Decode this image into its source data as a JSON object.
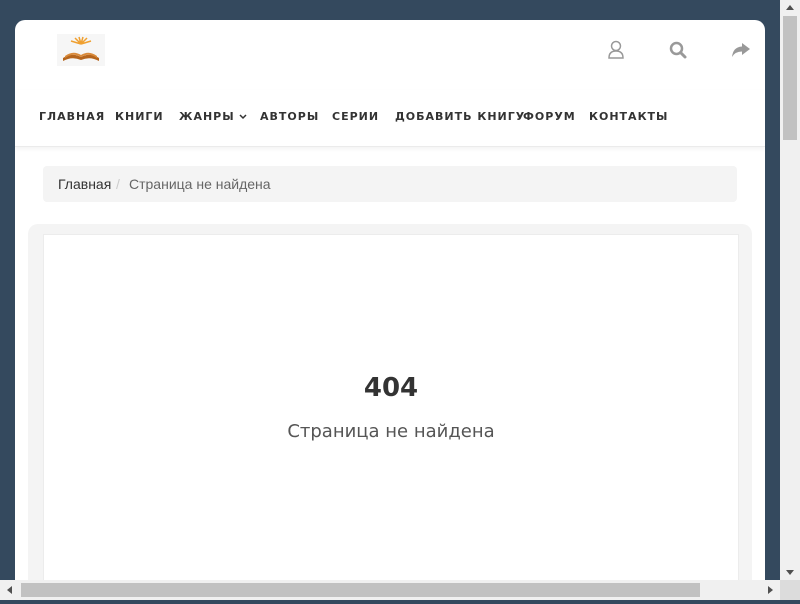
{
  "header": {
    "logo_icon": "open-book-icon",
    "icons": [
      "user-icon",
      "search-icon",
      "share-icon"
    ]
  },
  "nav": {
    "items": [
      {
        "label": "ГЛАВНАЯ"
      },
      {
        "label": "КНИГИ"
      },
      {
        "label": "ЖАНРЫ"
      },
      {
        "label": "АВТОРЫ"
      },
      {
        "label": "СЕРИИ"
      },
      {
        "label": "ДОБАВИТЬ КНИГУ"
      },
      {
        "label": "ФОРУМ"
      },
      {
        "label": "КОНТАКТЫ"
      }
    ]
  },
  "breadcrumb": {
    "home": "Главная",
    "separator": "/",
    "current": "Страница не найдена"
  },
  "error": {
    "code": "404",
    "message": "Страница не найдена"
  },
  "colors": {
    "background": "#34495e",
    "page": "#ffffff",
    "panel": "#f4f4f4",
    "text": "#333333",
    "icon": "#999999"
  }
}
